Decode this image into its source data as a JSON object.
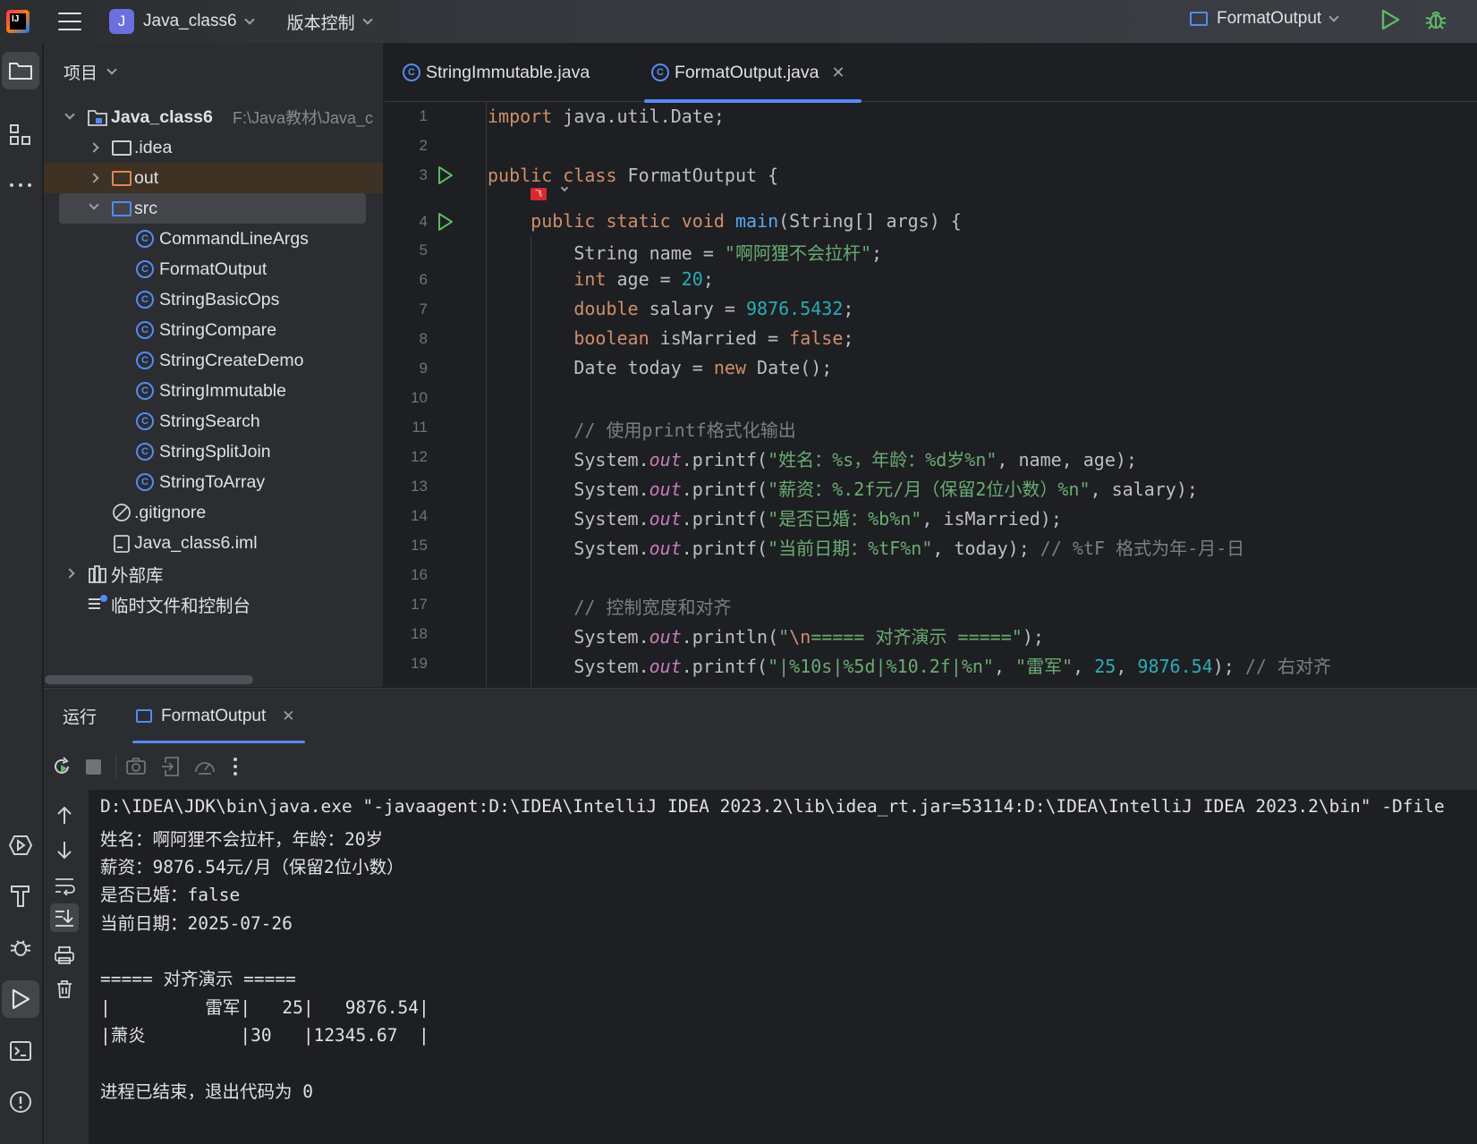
{
  "titlebar": {
    "project_badge": "J",
    "project_name": "Java_class6",
    "vcs_menu": "版本控制",
    "run_config": "FormatOutput"
  },
  "project_panel": {
    "title": "项目",
    "tree": [
      {
        "label": "Java_class6",
        "path": "F:\\Java教材\\Java_c",
        "type": "module",
        "bold": true
      },
      {
        "label": ".idea",
        "type": "folder"
      },
      {
        "label": "out",
        "type": "folder-orange"
      },
      {
        "label": "src",
        "type": "folder-blue"
      },
      {
        "label": "CommandLineArgs",
        "type": "class"
      },
      {
        "label": "FormatOutput",
        "type": "class"
      },
      {
        "label": "StringBasicOps",
        "type": "class"
      },
      {
        "label": "StringCompare",
        "type": "class"
      },
      {
        "label": "StringCreateDemo",
        "type": "class"
      },
      {
        "label": "StringImmutable",
        "type": "class"
      },
      {
        "label": "StringSearch",
        "type": "class"
      },
      {
        "label": "StringSplitJoin",
        "type": "class"
      },
      {
        "label": "StringToArray",
        "type": "class"
      },
      {
        "label": ".gitignore",
        "type": "ignore"
      },
      {
        "label": "Java_class6.iml",
        "type": "file"
      },
      {
        "label": "外部库",
        "type": "library"
      },
      {
        "label": "临时文件和控制台",
        "type": "scratch"
      }
    ]
  },
  "editor": {
    "tabs": [
      {
        "label": "StringImmutable.java",
        "active": false
      },
      {
        "label": "FormatOutput.java",
        "active": true
      }
    ],
    "line_numbers": [
      "1",
      "2",
      "3",
      "4",
      "5",
      "6",
      "7",
      "8",
      "9",
      "10",
      "11",
      "12",
      "13",
      "14",
      "15",
      "16",
      "17",
      "18",
      "19"
    ]
  },
  "run_panel": {
    "title": "运行",
    "tab_label": "FormatOutput",
    "console_lines": [
      "D:\\IDEA\\JDK\\bin\\java.exe \"-javaagent:D:\\IDEA\\IntelliJ IDEA 2023.2\\lib\\idea_rt.jar=53114:D:\\IDEA\\IntelliJ IDEA 2023.2\\bin\" -Dfile",
      "姓名：啊阿狸不会拉杆，年龄：20岁",
      "薪资：9876.54元/月（保留2位小数）",
      "是否已婚：false",
      "当前日期：2025-07-26",
      "",
      "===== 对齐演示 =====",
      "|         雷军|   25|   9876.54|",
      "|萧炎         |30   |12345.67  |",
      "",
      "进程已结束，退出代码为 0"
    ]
  },
  "colors": {
    "accent": "#548af7",
    "run_green": "#5fb865",
    "keyword": "#cf8e6d",
    "string": "#6aab73",
    "number": "#2aacb8"
  }
}
